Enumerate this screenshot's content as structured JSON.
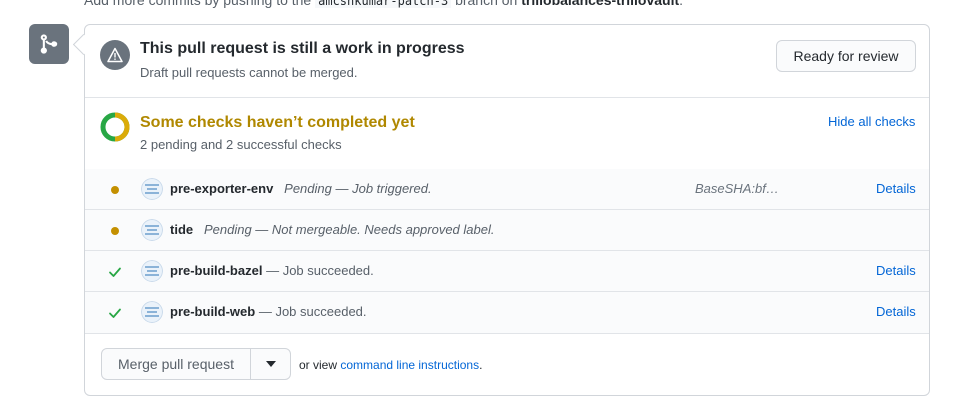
{
  "top_strip": {
    "prefix": "Add more commits by pushing to the",
    "branch": "amcshkumar-patch-3",
    "middle": "branch on",
    "repo": "trillobalances-trillovault",
    "suffix": "."
  },
  "draft": {
    "title": "This pull request is still a work in progress",
    "subtitle": "Draft pull requests cannot be merged.",
    "ready_button": "Ready for review"
  },
  "checks": {
    "title": "Some checks haven’t completed yet",
    "summary": "2 pending and 2 successful checks",
    "hide_link": "Hide all checks",
    "items": [
      {
        "name": "pre-exporter-env",
        "description": "Pending — Job triggered.",
        "state": "pending",
        "target": "BaseSHA:bf…",
        "details": "Details"
      },
      {
        "name": "tide",
        "description": "Pending — Not mergeable. Needs approved label.",
        "state": "pending",
        "target": "",
        "details": ""
      },
      {
        "name": "pre-build-bazel",
        "description": "— Job succeeded.",
        "state": "success",
        "target": "",
        "details": "Details"
      },
      {
        "name": "pre-build-web",
        "description": "— Job succeeded.",
        "state": "success",
        "target": "",
        "details": "Details"
      }
    ]
  },
  "merge": {
    "button": "Merge pull request",
    "or_view": "or view",
    "cli_link": "command line instructions",
    "cli_suffix": "."
  },
  "colors": {
    "pending": "#c49000",
    "success": "#28a745",
    "link": "#0366d6",
    "warning_title": "#b08800"
  }
}
